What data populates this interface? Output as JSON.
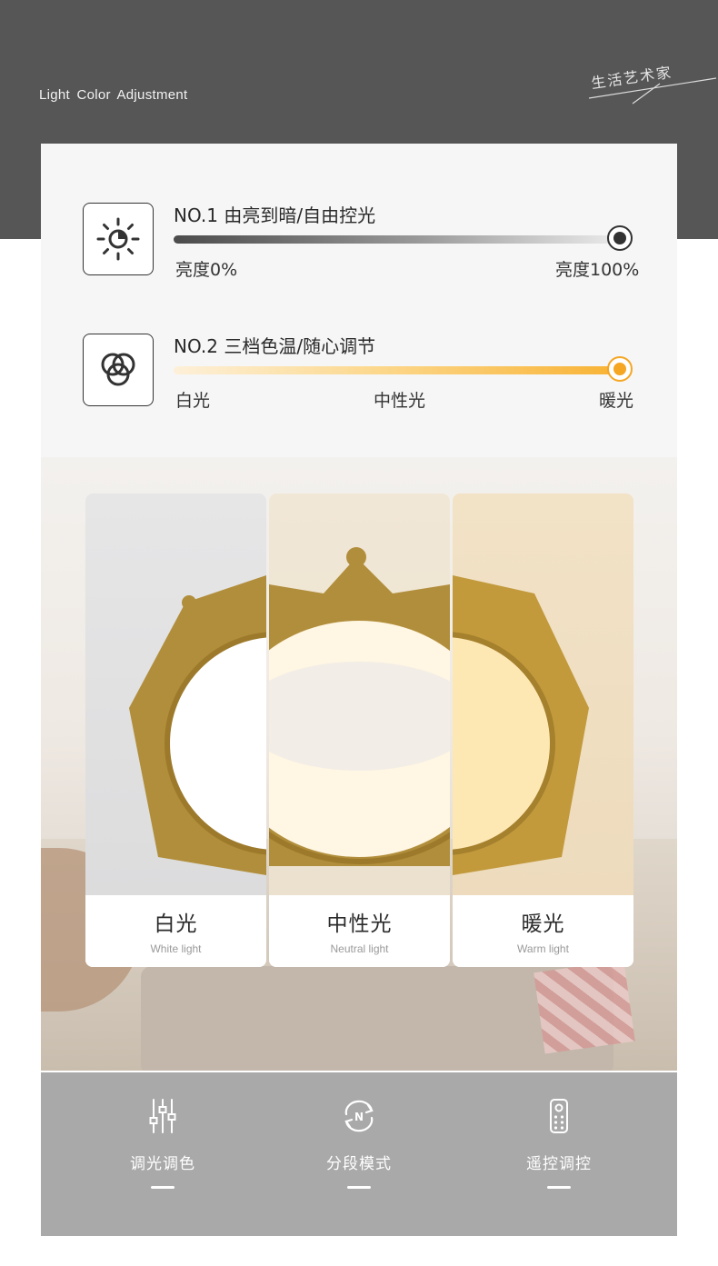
{
  "header": {
    "title": "Light  Color  Adjustment",
    "signature": "生活艺术家"
  },
  "features": [
    {
      "icon": "sun-icon",
      "heading": "NO.1  由亮到暗/自由控光",
      "scale_left": "亮度0%",
      "scale_right": "亮度100%",
      "level": 1.0
    },
    {
      "icon": "color-circles-icon",
      "heading": "NO.2  三档色温/随心调节",
      "scale_left": "白光",
      "scale_mid": "中性光",
      "scale_right": "暖光",
      "level": 1.0
    }
  ],
  "panels": [
    {
      "cn": "白光",
      "en": "White light"
    },
    {
      "cn": "中性光",
      "en": "Neutral light"
    },
    {
      "cn": "暖光",
      "en": "Warm light"
    }
  ],
  "bottom": [
    {
      "icon": "sliders-icon",
      "label": "调光调色"
    },
    {
      "icon": "mode-cycle-icon",
      "label": "分段模式"
    },
    {
      "icon": "remote-icon",
      "label": "遥控调控"
    }
  ],
  "colors": {
    "header_bg": "#565656",
    "card_bg": "#f6f6f6",
    "warm_accent": "#f5a623",
    "bottom_bg": "#a9a9a9",
    "gold": "#b8943a"
  }
}
